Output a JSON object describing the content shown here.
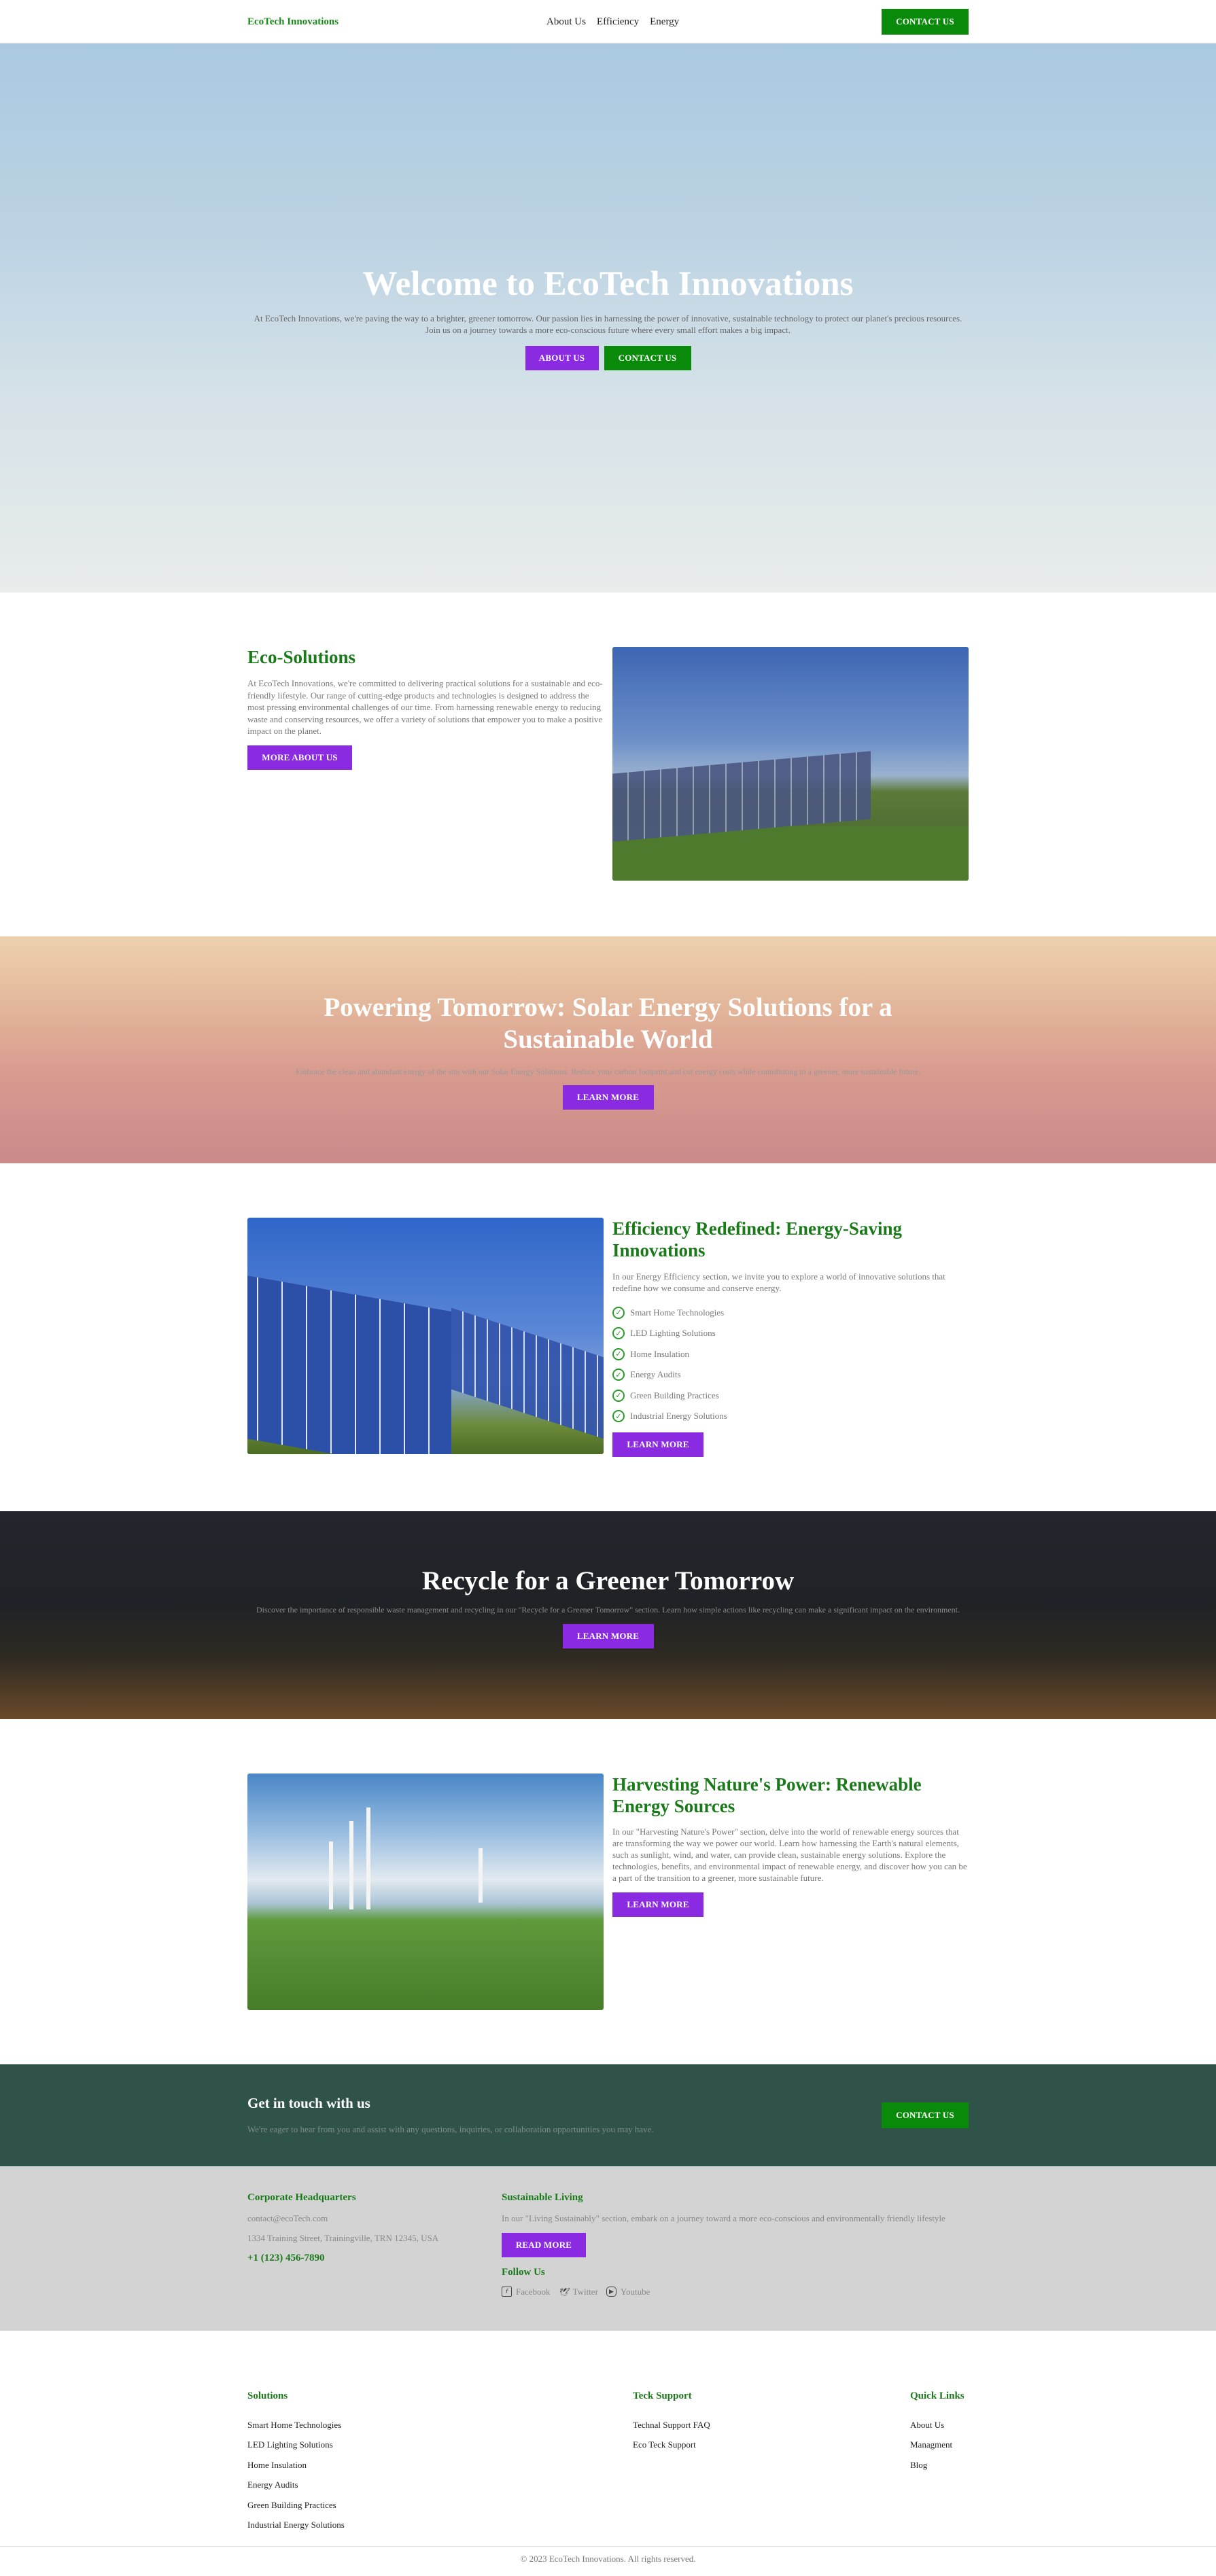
{
  "header": {
    "logo": "EcoTech Innovations",
    "nav": [
      "About Us",
      "Efficiency",
      "Energy"
    ],
    "contact_button": "CONTACT US"
  },
  "hero": {
    "title": "Welcome to EcoTech Innovations",
    "text": "At EcoTech Innovations, we're paving the way to a brighter, greener tomorrow. Our passion lies in harnessing the power of innovative, sustainable technology to protect our planet's precious resources. Join us on a journey towards a more eco-conscious future where every small effort makes a big impact.",
    "about_button": "ABOUT US",
    "contact_button": "CONTACT US"
  },
  "eco": {
    "title": "Eco-Solutions",
    "text": "At EcoTech Innovations, we're committed to delivering practical solutions for a sustainable and eco-friendly lifestyle. Our range of cutting-edge products and technologies is designed to address the most pressing environmental challenges of our time. From harnessing renewable energy to reducing waste and conserving resources, we offer a variety of solutions that empower you to make a positive impact on the planet.",
    "button": "MORE ABOUT US"
  },
  "solar_banner": {
    "title": "Powering Tomorrow: Solar Energy Solutions for a Sustainable World",
    "text": "Embrace the clean and abundant energy of the sun with our Solar Energy Solutions. Reduce your carbon footprint and cut energy costs while contributing to a greener, more sustainable future.",
    "button": "LEARN MORE"
  },
  "efficiency": {
    "title": "Efficiency Redefined: Energy-Saving Innovations",
    "text": "In our Energy Efficiency section, we invite you to explore a world of innovative solutions that redefine how we consume and conserve energy.",
    "items": [
      "Smart Home Technologies",
      "LED Lighting Solutions",
      "Home Insulation",
      "Energy Audits",
      "Green Building Practices",
      "Industrial Energy Solutions"
    ],
    "button": "LEARN MORE"
  },
  "recycle_banner": {
    "title": "Recycle for a Greener Tomorrow",
    "text": "Discover the importance of responsible waste management and recycling in our \"Recycle for a Greener Tomorrow\" section. Learn how simple actions like recycling can make a significant impact on the environment.",
    "button": "LEARN MORE"
  },
  "harvesting": {
    "title": "Harvesting Nature's Power: Renewable Energy Sources",
    "text": "In our \"Harvesting Nature's Power\" section, delve into the world of renewable energy sources that are transforming the way we power our world. Learn how harnessing the Earth's natural elements, such as sunlight, wind, and water, can provide clean, sustainable energy solutions. Explore the technologies, benefits, and environmental impact of renewable energy, and discover how you can be a part of the transition to a greener, more sustainable future.",
    "button": "LEARN MORE"
  },
  "contact_band": {
    "title": "Get in touch with us",
    "text": "We're eager to hear from you and assist with any questions, inquiries, or collaboration opportunities you may have.",
    "button": "CONTACT US"
  },
  "info": {
    "hq_title": "Corporate Headquarters",
    "email": "contact@ecoTech.com",
    "address": "1334 Training Street, Trainingville, TRN 12345, USA",
    "phone": "+1 (123) 456-7890",
    "living_title": "Sustainable Living",
    "living_text": "In our \"Living Sustainably\" section, embark on a journey toward a more eco-conscious and environmentally friendly lifestyle",
    "read_more": "READ MORE",
    "follow_title": "Follow Us",
    "social": [
      {
        "label": "Facebook",
        "icon": "facebook-icon"
      },
      {
        "label": "Twitter",
        "icon": "twitter-icon"
      },
      {
        "label": "Youtube",
        "icon": "youtube-icon"
      }
    ]
  },
  "footer": {
    "solutions_title": "Solutions",
    "solutions": [
      "Smart Home Technologies",
      "LED Lighting Solutions",
      "Home Insulation",
      "Energy Audits",
      "Green Building Practices",
      "Industrial Energy Solutions"
    ],
    "support_title": "Teck Support",
    "support": [
      "Technal Support FAQ",
      "Eco Teck Support"
    ],
    "links_title": "Quick Links",
    "links": [
      "About Us",
      "Managment",
      "Blog"
    ],
    "copyright": "© 2023 EcoTech Innovations. All rights reserved."
  },
  "colors": {
    "brand_green": "#0a8a0a",
    "accent_purple": "#8a2be2",
    "contact_band": "#2f5249",
    "info_band": "#d3d3d3"
  }
}
